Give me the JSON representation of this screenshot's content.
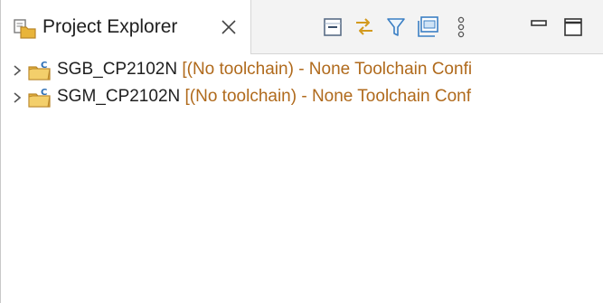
{
  "view": {
    "tab_title": "Project Explorer",
    "tab_icon": "project-explorer-icon",
    "close_icon": "close-icon"
  },
  "toolbar": {
    "buttons": [
      {
        "name": "collapse-all-icon"
      },
      {
        "name": "link-with-editor-icon"
      },
      {
        "name": "filter-icon"
      },
      {
        "name": "select-working-set-icon"
      },
      {
        "name": "view-menu-icon"
      },
      {
        "name": "minimize-icon"
      },
      {
        "name": "maximize-icon"
      }
    ]
  },
  "tree": {
    "items": [
      {
        "name": "SGB_CP2102N",
        "description": " [(No toolchain) - None Toolchain Confi"
      },
      {
        "name": "SGM_CP2102N",
        "description": " [(No toolchain) - None Toolchain Conf"
      }
    ]
  },
  "colors": {
    "decoration": "#b06a1c",
    "folder": "#e8b43a",
    "icon_blue": "#3b7fc4"
  }
}
